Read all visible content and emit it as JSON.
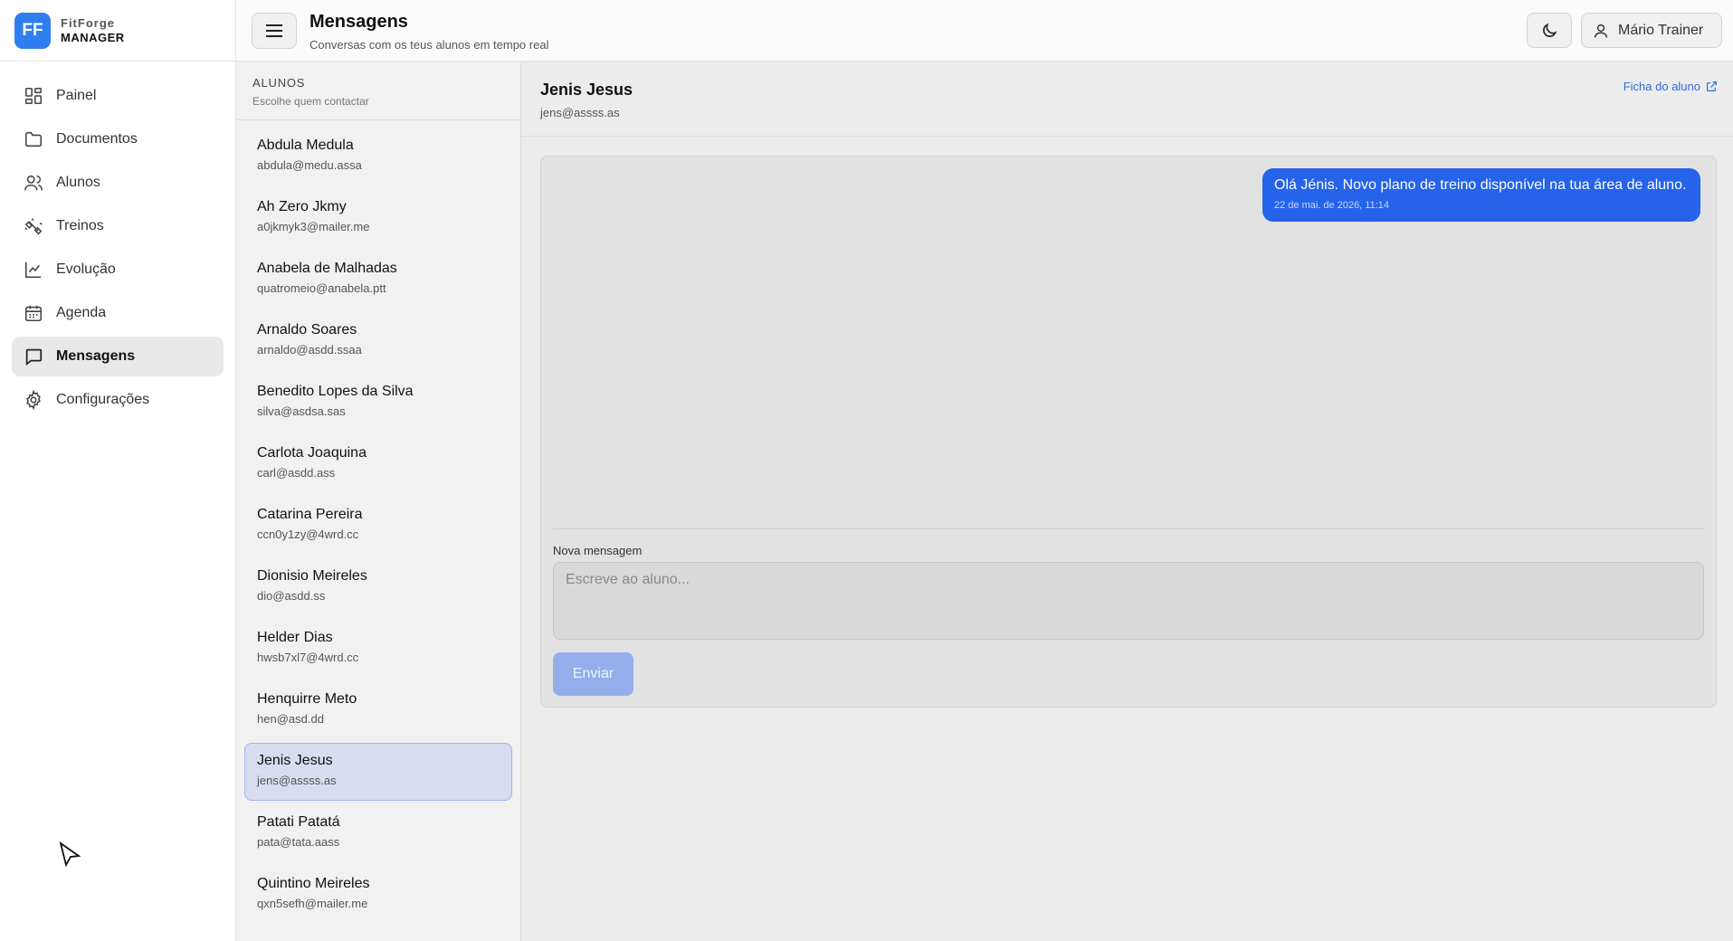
{
  "brand": {
    "logo": "FF",
    "name": "FitForge",
    "sub": "MANAGER"
  },
  "nav": [
    {
      "label": "Painel",
      "icon": "dashboard-icon"
    },
    {
      "label": "Documentos",
      "icon": "folder-icon"
    },
    {
      "label": "Alunos",
      "icon": "users-icon"
    },
    {
      "label": "Treinos",
      "icon": "dumbbell-icon"
    },
    {
      "label": "Evolução",
      "icon": "chart-line-icon"
    },
    {
      "label": "Agenda",
      "icon": "calendar-icon"
    },
    {
      "label": "Mensagens",
      "icon": "message-icon",
      "active": true
    },
    {
      "label": "Configurações",
      "icon": "gear-icon"
    }
  ],
  "header": {
    "title": "Mensagens",
    "subtitle": "Conversas com os teus alunos em tempo real",
    "user": "Mário Trainer"
  },
  "students_panel": {
    "title": "ALUNOS",
    "hint": "Escolhe quem contactar",
    "students": [
      {
        "name": "Abdula Medula",
        "email": "abdula@medu.assa"
      },
      {
        "name": "Ah Zero Jkmy",
        "email": "a0jkmyk3@mailer.me"
      },
      {
        "name": "Anabela de Malhadas",
        "email": "quatromeio@anabela.ptt"
      },
      {
        "name": "Arnaldo Soares",
        "email": "arnaldo@asdd.ssaa"
      },
      {
        "name": "Benedito Lopes da Silva",
        "email": "silva@asdsa.sas"
      },
      {
        "name": "Carlota Joaquina",
        "email": "carl@asdd.ass"
      },
      {
        "name": "Catarina Pereira",
        "email": "ccn0y1zy@4wrd.cc"
      },
      {
        "name": "Dionisio Meireles",
        "email": "dio@asdd.ss"
      },
      {
        "name": "Helder Dias",
        "email": "hwsb7xl7@4wrd.cc"
      },
      {
        "name": "Henquirre Meto",
        "email": "hen@asd.dd"
      },
      {
        "name": "Jenis Jesus",
        "email": "jens@assss.as",
        "selected": true
      },
      {
        "name": "Patati Patatá",
        "email": "pata@tata.aass"
      },
      {
        "name": "Quintino Meireles",
        "email": "qxn5sefh@mailer.me"
      }
    ]
  },
  "conversation": {
    "name": "Jenis Jesus",
    "email": "jens@assss.as",
    "profile_link": "Ficha do aluno",
    "messages": [
      {
        "text": "Olá Jénis. Novo plano de treino disponível na tua área de aluno.",
        "time": "22 de mai. de 2026, 11:14"
      }
    ],
    "new_message_label": "Nova mensagem",
    "input_placeholder": "Escreve ao aluno...",
    "send_label": "Enviar"
  },
  "colors": {
    "brand": "#2f7ef0",
    "bubble": "#2563eb",
    "selected": "#d7dcf0"
  }
}
